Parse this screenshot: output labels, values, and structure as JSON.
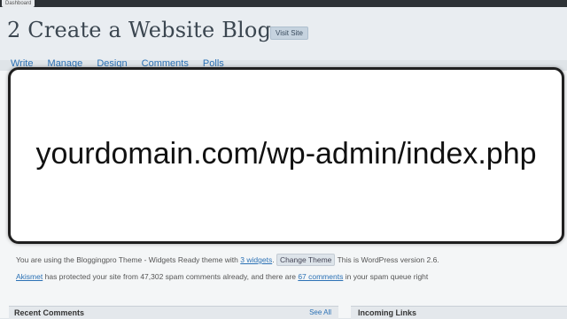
{
  "topbar": {
    "dashboard_tab": "Dashboard"
  },
  "header": {
    "title": "2 Create a Website Blog",
    "visit_site": "Visit Site"
  },
  "nav": {
    "items": [
      "Write",
      "Manage",
      "Design",
      "Comments",
      "Polls"
    ]
  },
  "overlay": {
    "url_text": "yourdomain.com/wp-admin/index.php"
  },
  "theme_line": {
    "prefix": "You are using the Bloggingpro Theme - Widgets Ready theme with",
    "widgets_link": "3 widgets",
    "change_theme_button": "Change Theme",
    "suffix": "This is WordPress version 2.6."
  },
  "akismet_line": {
    "akismet_link": "Akismet",
    "middle": "has protected your site from 47,302 spam comments already, and there are",
    "spam_link": "67 comments",
    "suffix": "in your spam queue right"
  },
  "boxes": {
    "recent_comments": "Recent Comments",
    "see_all": "See All",
    "incoming_links": "Incoming Links"
  }
}
